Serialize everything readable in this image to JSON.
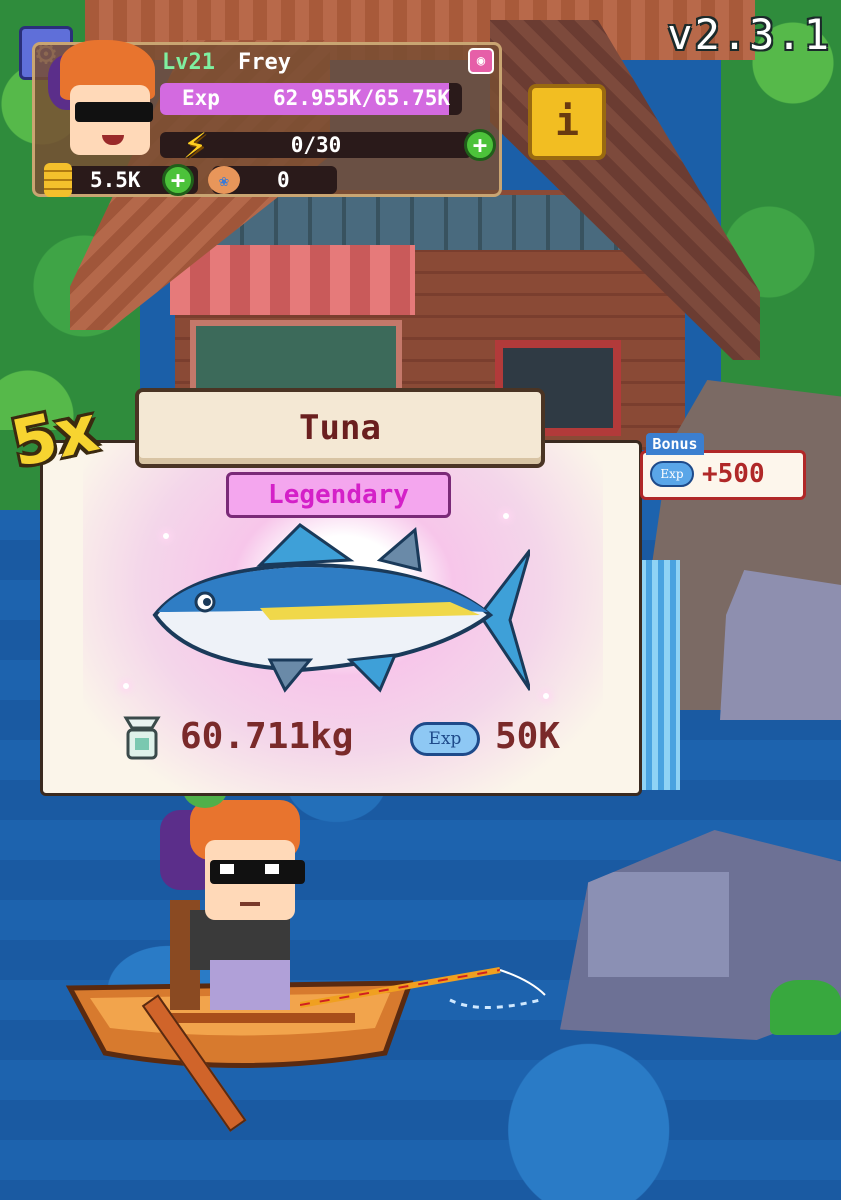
{
  "hud": {
    "version": "v2.3.1",
    "player": {
      "level": "Lv21",
      "name": "Frey",
      "exp_label": "Exp",
      "exp_value": "62.955K/65.75K",
      "exp_progress": 0.957,
      "energy": "0/30",
      "coins": "5.5K",
      "bait": "0"
    },
    "icons": {
      "settings": "gear-icon",
      "profile": "profile-icon",
      "info": "info-icon",
      "energy": "lightning-icon",
      "coins": "coin-stack-icon",
      "bait": "bait-icon",
      "add": "plus-icon"
    },
    "info_label": "i",
    "add_label": "+"
  },
  "catch": {
    "multiplier": "5x",
    "fish_name": "Tuna",
    "rarity": "Legendary",
    "rarity_color": "#d420c8",
    "weight": "60.711kg",
    "exp_icon_label": "Exp",
    "exp_reward": "50K",
    "bonus_label": "Bonus",
    "bonus_exp_label": "Exp",
    "bonus_value": "+500"
  }
}
